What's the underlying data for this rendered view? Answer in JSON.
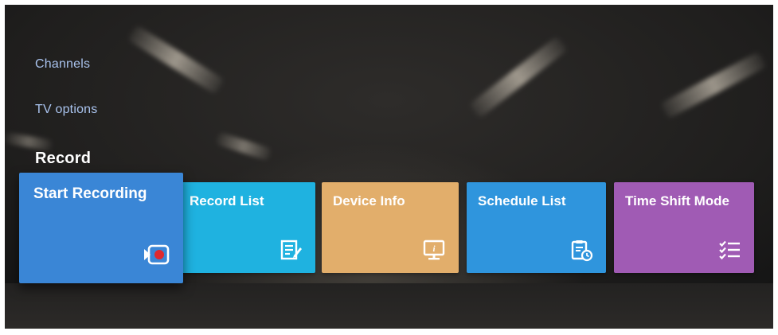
{
  "menu": {
    "items": [
      {
        "label": "Channels"
      },
      {
        "label": "TV options"
      },
      {
        "label": "Record"
      }
    ],
    "active_index": 2
  },
  "tiles": [
    {
      "label": "Start Recording",
      "icon": "start-recording-icon",
      "color": "#3a86d6",
      "focused": true
    },
    {
      "label": "Record List",
      "icon": "record-list-icon",
      "color": "#1fb2e0"
    },
    {
      "label": "Device Info",
      "icon": "device-info-icon",
      "color": "#e2ae6b"
    },
    {
      "label": "Schedule List",
      "icon": "schedule-list-icon",
      "color": "#2f95dd"
    },
    {
      "label": "Time Shift Mode",
      "icon": "time-shift-mode-icon",
      "color": "#a05bb4"
    }
  ]
}
